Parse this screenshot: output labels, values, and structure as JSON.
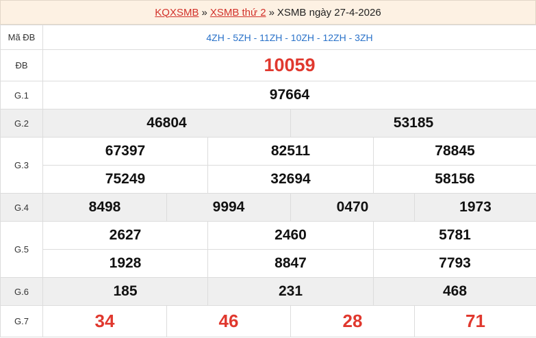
{
  "breadcrumb": {
    "home": "KQXSMB",
    "section": "XSMB thứ 2",
    "current": "XSMB ngày 27-4-2026",
    "separator": "»"
  },
  "rows": {
    "ma_db": {
      "label": "Mã ĐB",
      "codes": "4ZH - 5ZH - 11ZH - 10ZH - 12ZH - 3ZH"
    },
    "db": {
      "label": "ĐB",
      "numbers": [
        "10059"
      ]
    },
    "g1": {
      "label": "G.1",
      "numbers": [
        "97664"
      ]
    },
    "g2": {
      "label": "G.2",
      "numbers": [
        "46804",
        "53185"
      ]
    },
    "g3": {
      "label": "G.3",
      "numbers": [
        "67397",
        "82511",
        "78845",
        "75249",
        "32694",
        "58156"
      ]
    },
    "g4": {
      "label": "G.4",
      "numbers": [
        "8498",
        "9994",
        "0470",
        "1973"
      ]
    },
    "g5": {
      "label": "G.5",
      "numbers": [
        "2627",
        "2460",
        "5781",
        "1928",
        "8847",
        "7793"
      ]
    },
    "g6": {
      "label": "G.6",
      "numbers": [
        "185",
        "231",
        "468"
      ]
    },
    "g7": {
      "label": "G.7",
      "numbers": [
        "34",
        "46",
        "28",
        "71"
      ]
    }
  },
  "colors": {
    "accent_red": "#e0382e",
    "link_red": "#d2312a",
    "code_blue": "#2a72c9",
    "shade": "#efefef",
    "header_bg": "#fdf1e3"
  }
}
